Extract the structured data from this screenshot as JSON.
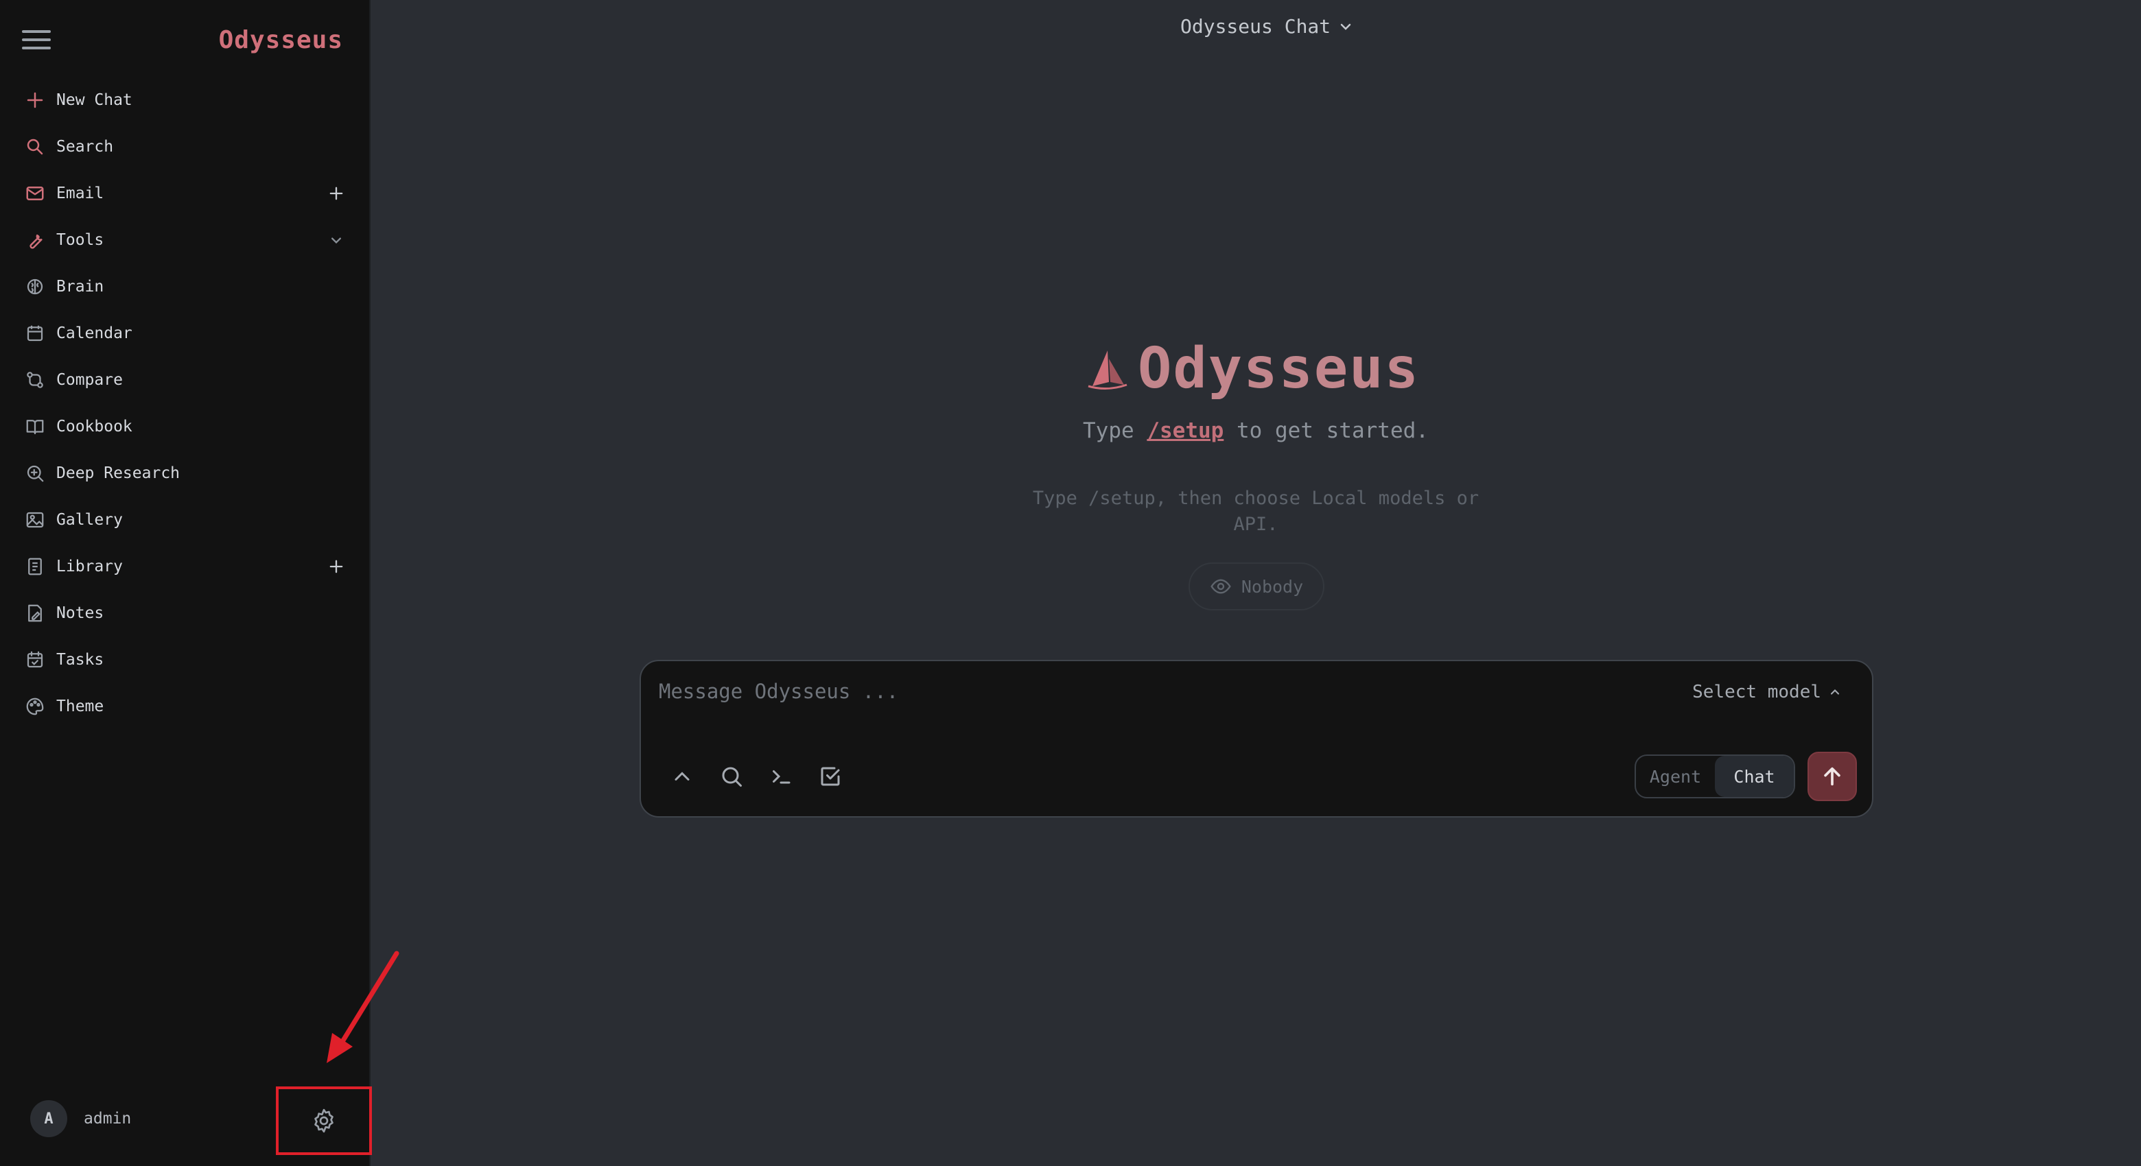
{
  "sidebar": {
    "brand": "Odysseus",
    "items": [
      {
        "label": "New Chat",
        "icon": "plus-icon"
      },
      {
        "label": "Search",
        "icon": "search-icon"
      },
      {
        "label": "Email",
        "icon": "mail-icon"
      },
      {
        "label": "Tools",
        "icon": "wrench-icon"
      },
      {
        "label": "Brain",
        "icon": "brain-icon"
      },
      {
        "label": "Calendar",
        "icon": "calendar-icon"
      },
      {
        "label": "Compare",
        "icon": "compare-icon"
      },
      {
        "label": "Cookbook",
        "icon": "book-icon"
      },
      {
        "label": "Deep Research",
        "icon": "research-icon"
      },
      {
        "label": "Gallery",
        "icon": "image-icon"
      },
      {
        "label": "Library",
        "icon": "library-icon"
      },
      {
        "label": "Notes",
        "icon": "note-icon"
      },
      {
        "label": "Tasks",
        "icon": "tasks-icon"
      },
      {
        "label": "Theme",
        "icon": "palette-icon"
      }
    ],
    "user": {
      "initial": "A",
      "name": "admin"
    }
  },
  "topbar": {
    "title": "Odysseus Chat"
  },
  "hero": {
    "title": "Odysseus",
    "subtitle_prefix": "Type",
    "subtitle_link": "/setup",
    "subtitle_suffix": "to get started.",
    "hint": "Type /setup, then choose Local models or API.",
    "visibility_label": "Nobody"
  },
  "composer": {
    "placeholder": "Message Odysseus ...",
    "model_select": "Select model",
    "modes": [
      "Agent",
      "Chat"
    ],
    "active_mode": "Chat"
  },
  "colors": {
    "accent": "#d0707a",
    "sidebar_bg": "#121212",
    "main_bg": "#2a2d33",
    "send_bg": "#6a3036",
    "annotation": "#e0202a"
  }
}
